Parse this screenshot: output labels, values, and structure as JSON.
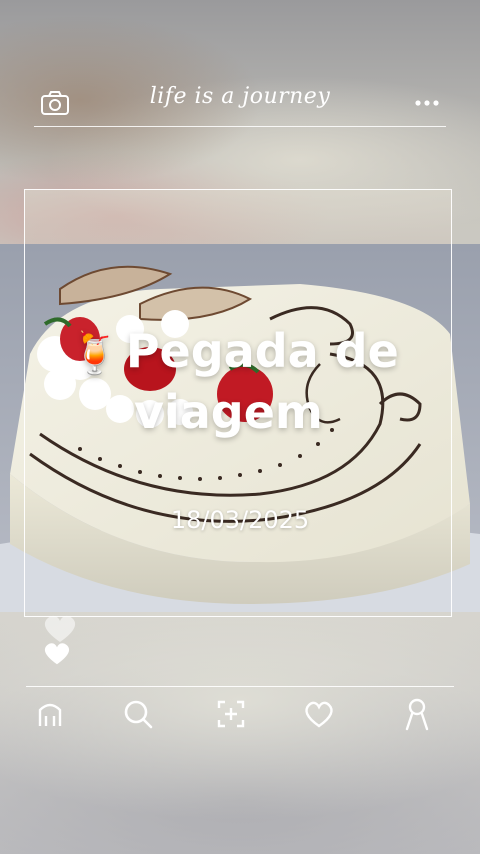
{
  "header": {
    "title": "life is a journey",
    "left_icon": "camera-icon",
    "right_icon": "more-dots-icon"
  },
  "post": {
    "emoji": "🍹",
    "title_line1": "Pegada de",
    "title_line2": "viagem",
    "date": "18/03/2025"
  },
  "reactions": {
    "icons": [
      "heart-outline-icon",
      "heart-filled-icon"
    ]
  },
  "nav": {
    "items": [
      {
        "name": "home",
        "icon": "home-icon"
      },
      {
        "name": "search",
        "icon": "search-icon"
      },
      {
        "name": "add",
        "icon": "add-post-icon"
      },
      {
        "name": "likes",
        "icon": "heart-icon"
      },
      {
        "name": "profile",
        "icon": "profile-icon"
      }
    ]
  },
  "colors": {
    "overlay_text": "#ffffff",
    "frame_line": "#ffffff"
  }
}
